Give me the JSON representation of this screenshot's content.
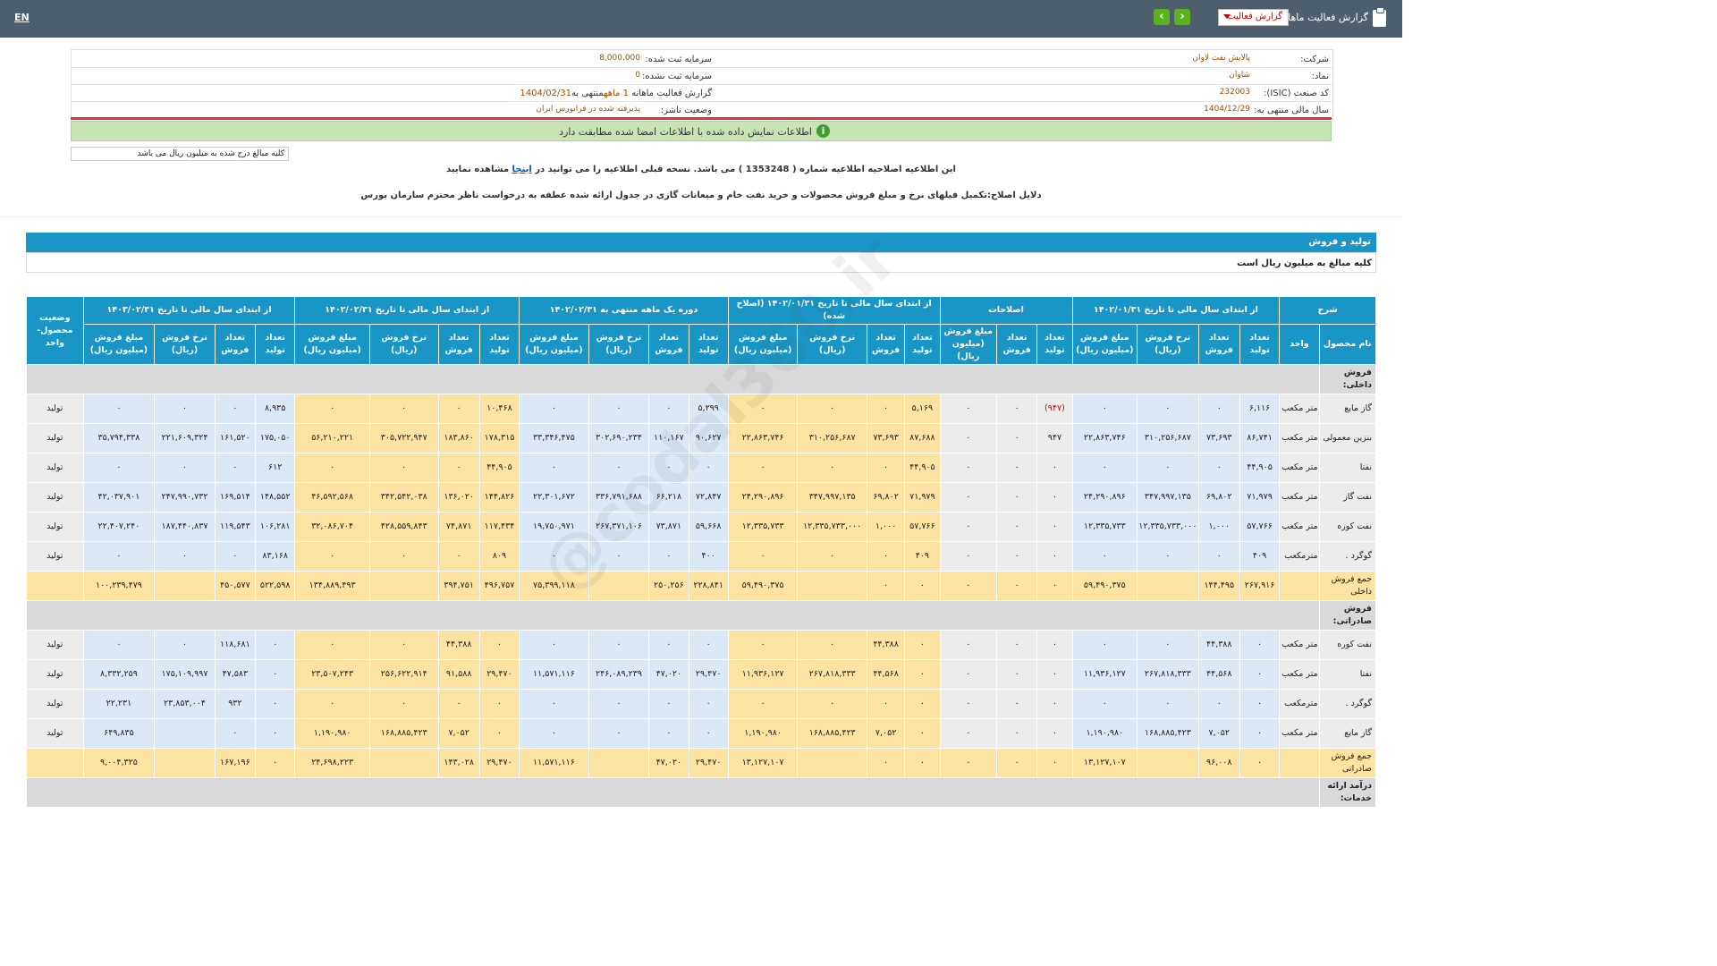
{
  "topbar": {
    "lang": "EN",
    "title": "گزارش فعالیت ماهانه",
    "select_value": "گزارش فعالیت",
    "next_icon": "chevron-right",
    "prev_icon": "chevron-left"
  },
  "info": {
    "company_label": "شرکت:",
    "company_value": "پالایش نفت لاوان",
    "symbol_label": "نماد:",
    "symbol_value": "شاوان",
    "isic_label": "کد صنعت (ISIC):",
    "isic_value": "232003",
    "fiscal_label": "سال مالی منتهی به:",
    "fiscal_value": "1404/12/29",
    "capital_label": "سرمایه ثبت شده:",
    "capital_value": "8,000,000",
    "unreg_capital_label": "سرمایه ثبت نشده:",
    "unreg_capital_value": "0",
    "report_label": "گزارش فعالیت ماهانه",
    "report_value": "1 ماهه",
    "report_suffix": "منتهی به",
    "report_date": "1404/02/31",
    "status_label": "وضعیت ناشر:",
    "status_value": "پذیرفته شده در فرابورس ایران"
  },
  "green_notice": "اطلاعات نمایش داده شده با اطلاعات امضا شده مطابقت دارد",
  "unit_note": "کلیه مبالغ درج شده به میلیون ریال می باشد",
  "correction": {
    "line1_a": "این اطلاعیه اصلاحیه اطلاعیه شماره ( 1353248 ) می باشد. نسخه قبلی اطلاعیه را می توانید در",
    "line1_link": "اینجا",
    "line1_b": "مشاهده نمایید",
    "line2": "دلایل اصلاح:تکمیل فیلهای نرخ و مبلغ فروش محصولات و خرید نفت خام و میعانات گازی در جدول ارائه شده عطفه به درخواست ناظر محترم سازمان بورس"
  },
  "section": {
    "title": "تولید و فروش",
    "subtitle": "کلیه مبالغ به میلیون ریال است"
  },
  "watermark": "@codal360.ir",
  "table": {
    "group_headers": [
      "شرح",
      "از ابتدای سال مالی تا تاریخ ۱۴۰۲/۰۱/۳۱",
      "اصلاحات",
      "از ابتدای سال مالی تا تاریخ ۱۴۰۲/۰۱/۳۱ (اصلاح شده)",
      "دوره یک ماهه منتهی به ۱۴۰۲/۰۲/۳۱",
      "از ابتدای سال مالی تا تاریخ ۱۴۰۲/۰۲/۳۱",
      "از ابتدای سال مالی تا تاریخ ۱۴۰۳/۰۲/۳۱",
      "وضعیت محصول-واحد"
    ],
    "sub_headers": [
      "نام محصول",
      "واحد",
      "تعداد تولید",
      "تعداد فروش",
      "نرخ فروش (ریال)",
      "مبلغ فروش (میلیون ریال)",
      "تعداد تولید",
      "تعداد فروش",
      "مبلغ فروش (میلیون ریال)",
      "تعداد تولید",
      "تعداد فروش",
      "نرخ فروش (ریال)",
      "مبلغ فروش (میلیون ریال)",
      "تعداد تولید",
      "تعداد فروش",
      "نرخ فروش (ریال)",
      "مبلغ فروش (میلیون ریال)",
      "تعداد تولید",
      "تعداد فروش",
      "نرخ فروش (ریال)",
      "مبلغ فروش (میلیون ریال)",
      "تعداد تولید",
      "تعداد فروش",
      "نرخ فروش (ریال)",
      "مبلغ فروش (میلیون ریال)"
    ],
    "rows": [
      {
        "type": "cat",
        "name": "فروش داخلی:"
      },
      {
        "type": "row",
        "name": "گاز مایع",
        "unit": "متر مکعب",
        "cells": [
          "۶,۱۱۶",
          "۰",
          "۰",
          "۰",
          "(۹۴۷)",
          "۰",
          "۰",
          "۵,۱۶۹",
          "۰",
          "۰",
          "۰",
          "۵,۲۹۹",
          "۰",
          "۰",
          "۰",
          "۱۰,۴۶۸",
          "۰",
          "۰",
          "۰",
          "۸,۹۳۵",
          "۰",
          "۰",
          "۰"
        ],
        "status": "تولید"
      },
      {
        "type": "row",
        "name": "بنزین معمولی",
        "unit": "متر مکعب",
        "cells": [
          "۸۶,۷۴۱",
          "۷۳,۶۹۳",
          "۳۱۰,۲۵۶,۶۸۷",
          "۲۲,۸۶۳,۷۴۶",
          "۹۴۷",
          "۰",
          "۰",
          "۸۷,۶۸۸",
          "۷۳,۶۹۳",
          "۳۱۰,۲۵۶,۶۸۷",
          "۲۲,۸۶۳,۷۴۶",
          "۹۰,۶۲۷",
          "۱۱۰,۱۶۷",
          "۳۰۲,۶۹۰,۲۳۴",
          "۳۳,۳۴۶,۴۷۵",
          "۱۷۸,۳۱۵",
          "۱۸۳,۸۶۰",
          "۳۰۵,۷۲۲,۹۴۷",
          "۵۶,۲۱۰,۲۲۱",
          "۱۷۵,۰۵۰",
          "۱۶۱,۵۲۰",
          "۲۲۱,۶۰۹,۳۲۴",
          "۳۵,۷۹۴,۳۳۸"
        ],
        "status": "تولید"
      },
      {
        "type": "row",
        "name": "نفتا",
        "unit": "متر مکعب",
        "cells": [
          "۴۴,۹۰۵",
          "۰",
          "۰",
          "۰",
          "۰",
          "۰",
          "۰",
          "۴۴,۹۰۵",
          "۰",
          "۰",
          "۰",
          "۰",
          "۰",
          "۰",
          "۰",
          "۴۴,۹۰۵",
          "۰",
          "۰",
          "۰",
          "۶۱۲",
          "۰",
          "۰",
          "۰"
        ],
        "status": "تولید"
      },
      {
        "type": "row",
        "name": "نفت گاز",
        "unit": "متر مکعب",
        "cells": [
          "۷۱,۹۷۹",
          "۶۹,۸۰۲",
          "۳۴۷,۹۹۷,۱۳۵",
          "۲۴,۲۹۰,۸۹۶",
          "۰",
          "۰",
          "۰",
          "۷۱,۹۷۹",
          "۶۹,۸۰۲",
          "۳۴۷,۹۹۷,۱۳۵",
          "۲۴,۲۹۰,۸۹۶",
          "۷۲,۸۴۷",
          "۶۶,۲۱۸",
          "۳۳۶,۷۹۱,۶۸۸",
          "۲۲,۳۰۱,۶۷۲",
          "۱۴۴,۸۲۶",
          "۱۳۶,۰۲۰",
          "۳۴۲,۵۴۲,۰۳۸",
          "۴۶,۵۹۲,۵۶۸",
          "۱۴۸,۵۵۲",
          "۱۶۹,۵۱۴",
          "۲۴۷,۹۹۰,۷۳۲",
          "۴۲,۰۳۷,۹۰۱"
        ],
        "status": "تولید"
      },
      {
        "type": "row",
        "name": "نفت کوره",
        "unit": "متر مکعب",
        "cells": [
          "۵۷,۷۶۶",
          "۱,۰۰۰",
          "۱۲,۳۳۵,۷۳۳,۰۰۰",
          "۱۲,۳۳۵,۷۳۳",
          "۰",
          "۰",
          "۰",
          "۵۷,۷۶۶",
          "۱,۰۰۰",
          "۱۲,۳۳۵,۷۳۳,۰۰۰",
          "۱۲,۳۳۵,۷۳۳",
          "۵۹,۶۶۸",
          "۷۳,۸۷۱",
          "۲۶۷,۳۷۱,۱۰۶",
          "۱۹,۷۵۰,۹۷۱",
          "۱۱۷,۴۳۴",
          "۷۴,۸۷۱",
          "۴۲۸,۵۵۹,۸۴۳",
          "۳۲,۰۸۶,۷۰۴",
          "۱۰۶,۲۸۱",
          "۱۱۹,۵۴۳",
          "۱۸۷,۴۴۰,۸۳۷",
          "۲۲,۴۰۷,۲۴۰"
        ],
        "status": "تولید"
      },
      {
        "type": "row",
        "name": "گوگرد .",
        "unit": "مترمکعب",
        "cells": [
          "۴۰۹",
          "۰",
          "۰",
          "۰",
          "۰",
          "۰",
          "۰",
          "۴۰۹",
          "۰",
          "۰",
          "۰",
          "۴۰۰",
          "۰",
          "۰",
          "۰",
          "۸۰۹",
          "۰",
          "۰",
          "۰",
          "۸۳,۱۶۸",
          "۰",
          "۰",
          "۰"
        ],
        "status": "تولید"
      },
      {
        "type": "total",
        "name": "جمع فروش داخلی",
        "unit": "",
        "cells": [
          "۲۶۷,۹۱۶",
          "۱۴۴,۴۹۵",
          "",
          "۵۹,۴۹۰,۳۷۵",
          "۰",
          "۰",
          "۰",
          "۰",
          "۰",
          "",
          "۵۹,۴۹۰,۳۷۵",
          "۲۲۸,۸۴۱",
          "۲۵۰,۲۵۶",
          "",
          "۷۵,۳۹۹,۱۱۸",
          "۴۹۶,۷۵۷",
          "۳۹۴,۷۵۱",
          "",
          "۱۳۴,۸۸۹,۴۹۳",
          "۵۲۲,۵۹۸",
          "۴۵۰,۵۷۷",
          "",
          "۱۰۰,۲۳۹,۴۷۹"
        ],
        "status": ""
      },
      {
        "type": "cat",
        "name": "فروش صادراتی:"
      },
      {
        "type": "row",
        "name": "نفت کوره",
        "unit": "متر مکعب",
        "cells": [
          "۰",
          "۴۴,۳۸۸",
          "۰",
          "۰",
          "۰",
          "۰",
          "۰",
          "۰",
          "۴۴,۳۸۸",
          "۰",
          "۰",
          "۰",
          "۰",
          "۰",
          "۰",
          "۰",
          "۴۴,۳۸۸",
          "۰",
          "۰",
          "۰",
          "۱۱۸,۶۸۱",
          "۰",
          "۰"
        ],
        "status": "تولید"
      },
      {
        "type": "row",
        "name": "نفتا",
        "unit": "متر مکعب",
        "cells": [
          "۰",
          "۴۴,۵۶۸",
          "۲۶۷,۸۱۸,۳۳۳",
          "۱۱,۹۳۶,۱۲۷",
          "۰",
          "۰",
          "۰",
          "۰",
          "۴۴,۵۶۸",
          "۲۶۷,۸۱۸,۳۳۳",
          "۱۱,۹۳۶,۱۲۷",
          "۲۹,۴۷۰",
          "۴۷,۰۲۰",
          "۲۴۶,۰۸۹,۲۳۹",
          "۱۱,۵۷۱,۱۱۶",
          "۲۹,۴۷۰",
          "۹۱,۵۸۸",
          "۲۵۶,۶۲۲,۹۱۴",
          "۲۳,۵۰۷,۲۴۳",
          "۰",
          "۴۷,۵۸۳",
          "۱۷۵,۱۰۹,۹۹۷",
          "۸,۳۳۲,۲۵۹"
        ],
        "status": "تولید"
      },
      {
        "type": "row",
        "name": "گوگرد .",
        "unit": "مترمکعب",
        "cells": [
          "۰",
          "۰",
          "۰",
          "۰",
          "۰",
          "۰",
          "۰",
          "۰",
          "۰",
          "۰",
          "۰",
          "۰",
          "۰",
          "۰",
          "۰",
          "۰",
          "۰",
          "۰",
          "۰",
          "۰",
          "۹۳۲",
          "۲۳,۸۵۳,۰۰۴",
          "۲۲,۲۳۱"
        ],
        "status": "تولید"
      },
      {
        "type": "row",
        "name": "گاز مایع",
        "unit": "متر مکعب",
        "cells": [
          "۰",
          "۷,۰۵۲",
          "۱۶۸,۸۸۵,۴۲۳",
          "۱,۱۹۰,۹۸۰",
          "۰",
          "۰",
          "۰",
          "۰",
          "۷,۰۵۲",
          "۱۶۸,۸۸۵,۴۲۳",
          "۱,۱۹۰,۹۸۰",
          "۰",
          "۰",
          "۰",
          "۰",
          "۰",
          "۷,۰۵۲",
          "۱۶۸,۸۸۵,۴۲۳",
          "۱,۱۹۰,۹۸۰",
          "۰",
          "۰",
          "",
          "۶۴۹,۸۳۵"
        ],
        "status": "تولید"
      },
      {
        "type": "total",
        "name": "جمع فروش صادراتی",
        "unit": "",
        "cells": [
          "۰",
          "۹۶,۰۰۸",
          "",
          "۱۳,۱۲۷,۱۰۷",
          "۰",
          "۰",
          "۰",
          "۰",
          "۰",
          "",
          "۱۳,۱۲۷,۱۰۷",
          "۲۹,۴۷۰",
          "۴۷,۰۲۰",
          "",
          "۱۱,۵۷۱,۱۱۶",
          "۲۹,۴۷۰",
          "۱۴۳,۰۲۸",
          "",
          "۲۴,۶۹۸,۲۲۳",
          "۰",
          "۱۶۷,۱۹۶",
          "",
          "۹,۰۰۴,۳۲۵"
        ],
        "status": ""
      },
      {
        "type": "cat",
        "name": "درآمد ارائه خدمات:"
      }
    ]
  },
  "colors": {
    "header": "#1a96c6",
    "topbar": "#4d5f6d",
    "yellow": "#fde3a1",
    "blue": "#dbe9f7"
  }
}
